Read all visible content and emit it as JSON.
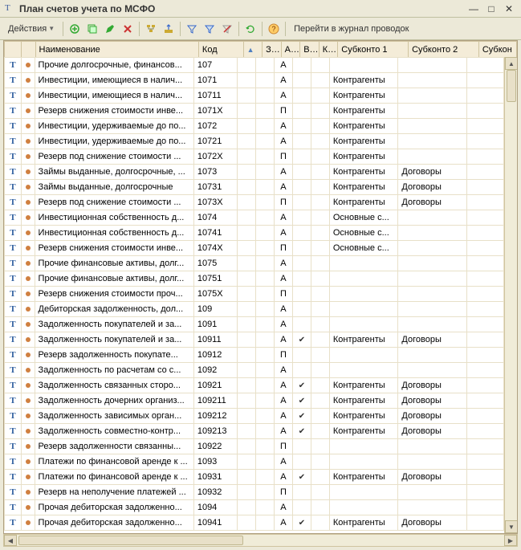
{
  "window": {
    "title": "План счетов учета по МСФО"
  },
  "toolbar": {
    "actions_label": "Действия",
    "journal_link": "Перейти в журнал проводок"
  },
  "columns": {
    "name": "Наименование",
    "code": "Код",
    "sort": "",
    "z": "З...",
    "a": "А...",
    "v": "В...",
    "k": "К...",
    "sub1": "Субконто 1",
    "sub2": "Субконто 2",
    "sub3": "Субкон"
  },
  "rows": [
    {
      "name": "Прочие долгосрочные, финансов...",
      "code": "107",
      "a": "А",
      "v": "",
      "s1": "",
      "s2": ""
    },
    {
      "name": "Инвестиции, имеющиеся в налич...",
      "code": "1071",
      "a": "А",
      "v": "",
      "s1": "Контрагенты",
      "s2": ""
    },
    {
      "name": "Инвестиции, имеющиеся в налич...",
      "code": "10711",
      "a": "А",
      "v": "",
      "s1": "Контрагенты",
      "s2": ""
    },
    {
      "name": "Резерв снижения стоимости инве...",
      "code": "1071X",
      "a": "П",
      "v": "",
      "s1": "Контрагенты",
      "s2": ""
    },
    {
      "name": "Инвестиции, удерживаемые до по...",
      "code": "1072",
      "a": "А",
      "v": "",
      "s1": "Контрагенты",
      "s2": ""
    },
    {
      "name": "Инвестиции, удерживаемые до по...",
      "code": "10721",
      "a": "А",
      "v": "",
      "s1": "Контрагенты",
      "s2": ""
    },
    {
      "name": "Резерв под снижение стоимости ...",
      "code": "1072X",
      "a": "П",
      "v": "",
      "s1": "Контрагенты",
      "s2": ""
    },
    {
      "name": "Займы выданные, долгосрочные, ...",
      "code": "1073",
      "a": "А",
      "v": "",
      "s1": "Контрагенты",
      "s2": "Договоры"
    },
    {
      "name": "Займы выданные, долгосрочные",
      "code": "10731",
      "a": "А",
      "v": "",
      "s1": "Контрагенты",
      "s2": "Договоры"
    },
    {
      "name": "Резерв под снижение стоимости ...",
      "code": "1073X",
      "a": "П",
      "v": "",
      "s1": "Контрагенты",
      "s2": "Договоры"
    },
    {
      "name": "Инвестиционная собственность д...",
      "code": "1074",
      "a": "А",
      "v": "",
      "s1": "Основные с...",
      "s2": ""
    },
    {
      "name": "Инвестиционная собственность д...",
      "code": "10741",
      "a": "А",
      "v": "",
      "s1": "Основные с...",
      "s2": ""
    },
    {
      "name": "Резерв снижения стоимости инве...",
      "code": "1074X",
      "a": "П",
      "v": "",
      "s1": "Основные с...",
      "s2": ""
    },
    {
      "name": "Прочие финансовые активы, долг...",
      "code": "1075",
      "a": "А",
      "v": "",
      "s1": "",
      "s2": ""
    },
    {
      "name": "Прочие финансовые активы, долг...",
      "code": "10751",
      "a": "А",
      "v": "",
      "s1": "",
      "s2": ""
    },
    {
      "name": "Резерв снижения стоимости проч...",
      "code": "1075X",
      "a": "П",
      "v": "",
      "s1": "",
      "s2": ""
    },
    {
      "name": "Дебиторская задолженность, дол...",
      "code": "109",
      "a": "А",
      "v": "",
      "s1": "",
      "s2": ""
    },
    {
      "name": "Задолженность покупателей и за...",
      "code": "1091",
      "a": "А",
      "v": "",
      "s1": "",
      "s2": ""
    },
    {
      "name": "Задолженность покупателей и за...",
      "code": "10911",
      "a": "А",
      "v": "✔",
      "s1": "Контрагенты",
      "s2": "Договоры"
    },
    {
      "name": "Резерв задолженность покупате...",
      "code": "10912",
      "a": "П",
      "v": "",
      "s1": "",
      "s2": ""
    },
    {
      "name": "Задолженность по расчетам со с...",
      "code": "1092",
      "a": "А",
      "v": "",
      "s1": "",
      "s2": ""
    },
    {
      "name": "Задолженность связанных сторо...",
      "code": "10921",
      "a": "А",
      "v": "✔",
      "s1": "Контрагенты",
      "s2": "Договоры"
    },
    {
      "name": "Задолженность дочерних организ...",
      "code": "109211",
      "a": "А",
      "v": "✔",
      "s1": "Контрагенты",
      "s2": "Договоры"
    },
    {
      "name": "Задолженность зависимых орган...",
      "code": "109212",
      "a": "А",
      "v": "✔",
      "s1": "Контрагенты",
      "s2": "Договоры"
    },
    {
      "name": "Задолженность совместно-контр...",
      "code": "109213",
      "a": "А",
      "v": "✔",
      "s1": "Контрагенты",
      "s2": "Договоры"
    },
    {
      "name": "Резерв задолженности связанны...",
      "code": "10922",
      "a": "П",
      "v": "",
      "s1": "",
      "s2": ""
    },
    {
      "name": "Платежи по финансовой аренде к ...",
      "code": "1093",
      "a": "А",
      "v": "",
      "s1": "",
      "s2": ""
    },
    {
      "name": "Платежи по финансовой аренде к ...",
      "code": "10931",
      "a": "А",
      "v": "✔",
      "s1": "Контрагенты",
      "s2": "Договоры"
    },
    {
      "name": "Резерв на неполучение платежей ...",
      "code": "10932",
      "a": "П",
      "v": "",
      "s1": "",
      "s2": ""
    },
    {
      "name": "Прочая дебиторская задолженно...",
      "code": "1094",
      "a": "А",
      "v": "",
      "s1": "",
      "s2": ""
    },
    {
      "name": "Прочая дебиторская задолженно...",
      "code": "10941",
      "a": "А",
      "v": "✔",
      "s1": "Контрагенты",
      "s2": "Договоры"
    }
  ]
}
